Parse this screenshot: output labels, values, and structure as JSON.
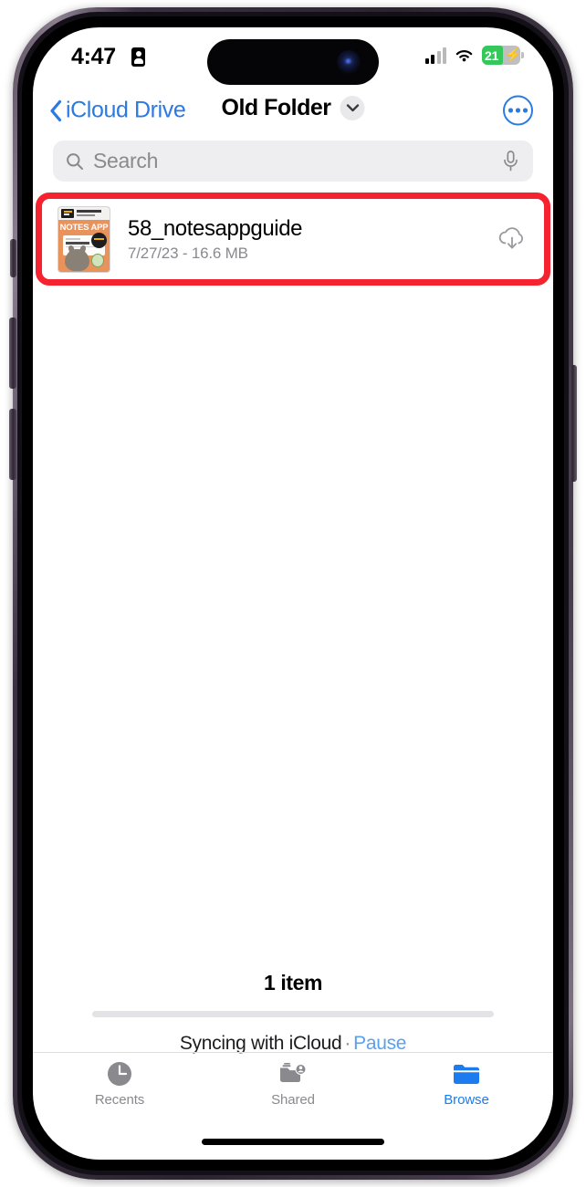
{
  "status_bar": {
    "time": "4:47",
    "recording_icon": "id-card-icon",
    "cellular_icon": "cellular-bars-icon",
    "wifi_icon": "wifi-icon",
    "battery_percent": "21",
    "battery_charging": true,
    "battery_color": "#34c759"
  },
  "nav": {
    "back_label": "iCloud Drive",
    "title": "Old Folder",
    "chevron_icon": "chevron-down-icon",
    "more_icon": "ellipsis-circle-icon",
    "accent_color": "#2a7ae2"
  },
  "search": {
    "placeholder": "Search",
    "value": "",
    "search_icon": "search-icon",
    "mic_icon": "microphone-icon"
  },
  "files": {
    "highlight_color": "#f5232f",
    "items": [
      {
        "name": "58_notesappguide",
        "subtitle": "7/27/23 - 16.6 MB",
        "date": "7/27/23",
        "size": "16.6 MB",
        "status_icon": "cloud-download-icon",
        "thumbnail": {
          "title": "NOTES APP",
          "kind": "pdf-guide-cover",
          "background_color": "#e8935c"
        }
      }
    ]
  },
  "footer": {
    "item_count": "1 item",
    "sync_status": "Syncing with iCloud",
    "separator": "·",
    "pause_label": "Pause",
    "pause_color": "#5aa0ef"
  },
  "tabbar": {
    "items": [
      {
        "label": "Recents",
        "icon": "clock-icon",
        "active": false
      },
      {
        "label": "Shared",
        "icon": "shared-folder-icon",
        "active": false
      },
      {
        "label": "Browse",
        "icon": "folder-icon",
        "active": true
      }
    ],
    "active_color": "#1d7bf0",
    "inactive_color": "#8a8a8e"
  }
}
